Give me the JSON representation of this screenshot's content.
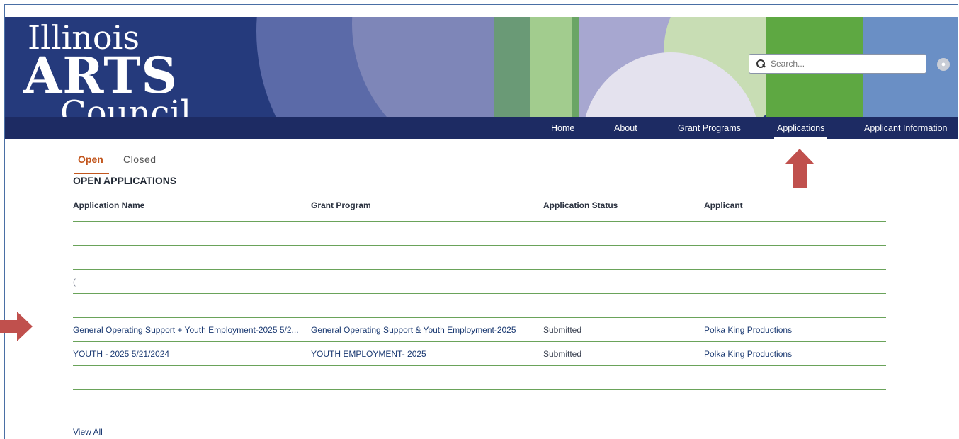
{
  "logo": {
    "line1": "Illinois",
    "line2": "ARTS",
    "line3": "Council"
  },
  "search": {
    "placeholder": "Search..."
  },
  "nav": {
    "items": [
      {
        "label": "Home"
      },
      {
        "label": "About"
      },
      {
        "label": "Grant Programs"
      },
      {
        "label": "Applications",
        "active": true
      },
      {
        "label": "Applicant Information"
      }
    ]
  },
  "tabs": {
    "open": "Open",
    "closed": "Closed"
  },
  "section_title": "OPEN APPLICATIONS",
  "table": {
    "headers": [
      "Application Name",
      "Grant Program",
      "Application Status",
      "Applicant"
    ],
    "rows": [
      {
        "name": "",
        "program": "",
        "status": "",
        "applicant": ""
      },
      {
        "name": "",
        "program": "",
        "status": "",
        "applicant": ""
      },
      {
        "name": "(",
        "program": "",
        "status": "",
        "applicant": ""
      },
      {
        "name": "",
        "program": "",
        "status": "",
        "applicant": ""
      },
      {
        "name": "General Operating Support + Youth Employment-2025 5/2...",
        "program": "General Operating Support & Youth Employment-2025",
        "status": "Submitted",
        "applicant": "Polka King Productions"
      },
      {
        "name": "YOUTH - 2025 5/21/2024",
        "program": "YOUTH EMPLOYMENT- 2025",
        "status": "Submitted",
        "applicant": "Polka King Productions"
      },
      {
        "name": "",
        "program": "",
        "status": "",
        "applicant": ""
      },
      {
        "name": "",
        "program": "",
        "status": "",
        "applicant": ""
      }
    ]
  },
  "view_all": "View All",
  "colors": {
    "accent_orange": "#c2561d",
    "rule_green": "#6aa35a",
    "nav_bg": "#1d2b63",
    "annotation_red": "#c0504d"
  }
}
